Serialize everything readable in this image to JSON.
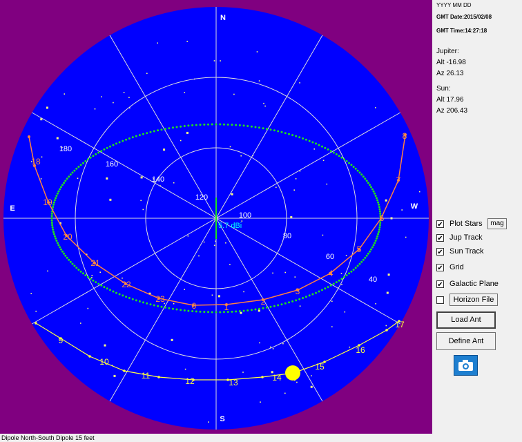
{
  "colors": {
    "frame": "#800080",
    "sky": "#0000ff",
    "grid": "#dddddd",
    "star": "#ffff80",
    "jupiter_track": "#ff8040",
    "sun_track": "#ffff40",
    "sun": "#ffff00",
    "galactic_plane": "#20e020",
    "gain_label": "#00ffff",
    "orange_label": "#ff9040"
  },
  "sky": {
    "compass": {
      "north": "N",
      "south": "S",
      "east": "E",
      "west": "W"
    },
    "gain_label": "5.7 dBi",
    "jupiter_hour_labels": [
      "18",
      "19",
      "20",
      "21",
      "22",
      "23",
      "0",
      "1",
      "2",
      "3",
      "4",
      "5",
      "6",
      "7",
      "8"
    ],
    "sun_hour_labels": [
      "9",
      "10",
      "11",
      "12",
      "13",
      "14",
      "15",
      "16",
      "17"
    ],
    "galactic_labels": [
      "180",
      "160",
      "140",
      "120",
      "100",
      "80",
      "60",
      "40"
    ]
  },
  "side": {
    "date_format": "YYYY MM DD",
    "gmt_date": "GMT Date:2015/02/08",
    "gmt_time": "GMT Time:14:27:18",
    "jupiter": {
      "name": "Jupiter:",
      "alt": "Alt -16.98",
      "az": "Az 26.13"
    },
    "sun": {
      "name": "Sun:",
      "alt": "Alt 17.96",
      "az": "Az 206.43"
    },
    "checkboxes": [
      {
        "label": "Plot Stars",
        "checked": true
      },
      {
        "label": "Jup Track",
        "checked": true
      },
      {
        "label": "Sun Track",
        "checked": true
      },
      {
        "label": "Grid",
        "checked": true
      },
      {
        "label": "Galactic Plane",
        "checked": true
      },
      {
        "label": "Horizon File",
        "checked": false
      }
    ],
    "mag_button": "mag",
    "load_ant_button": "Load Ant",
    "define_ant_button": "Define Ant",
    "camera_icon": "camera-icon"
  },
  "status": {
    "text": "Dipole North-South Dipole 15 feet"
  }
}
